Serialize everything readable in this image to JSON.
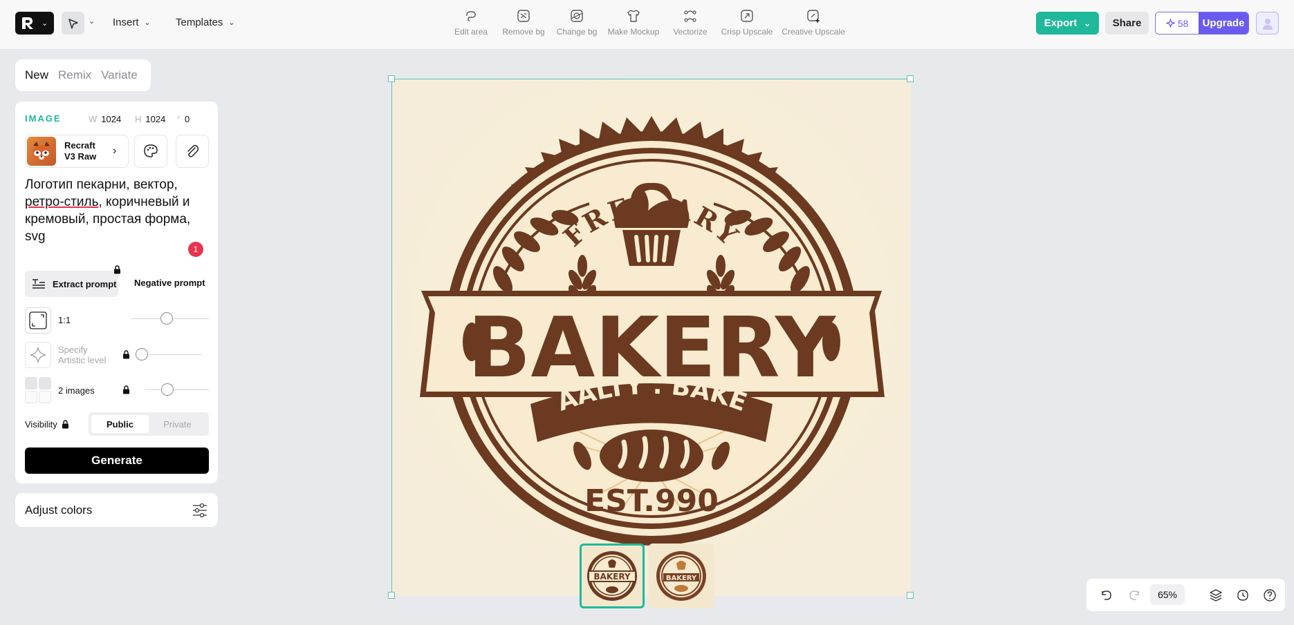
{
  "topbar": {
    "insert_label": "Insert",
    "templates_label": "Templates",
    "tools": [
      {
        "label": "Edit area",
        "icon": "lasso-icon"
      },
      {
        "label": "Remove bg",
        "icon": "remove-bg-icon"
      },
      {
        "label": "Change bg",
        "icon": "change-bg-icon"
      },
      {
        "label": "Make Mockup",
        "icon": "tshirt-icon"
      },
      {
        "label": "Vectorize",
        "icon": "vector-nodes-icon"
      },
      {
        "label": "Crisp Upscale",
        "icon": "upscale-icon"
      },
      {
        "label": "Creative Upscale",
        "icon": "creative-upscale-icon"
      }
    ],
    "export_label": "Export",
    "share_label": "Share",
    "credits": "58",
    "upgrade_label": "Upgrade"
  },
  "mode_tabs": {
    "new": "New",
    "remix": "Remix",
    "variate": "Variate"
  },
  "panel": {
    "image_label": "IMAGE",
    "width_key": "W",
    "width": "1024",
    "height_key": "H",
    "height": "1024",
    "rotation": "0",
    "model_name_1": "Recraft",
    "model_name_2": "V3 Raw",
    "prompt_part1": "Логотип пекарни, вектор, ",
    "prompt_underlined": "ретро-стиль",
    "prompt_part2": ", коричневый и кремовый, простая форма, svg",
    "prompt_badge": "1",
    "extract_label": "Extract prompt",
    "negative_label": "Negative prompt",
    "ratio_label": "1:1",
    "artistic_label_1": "Specify",
    "artistic_label_2": "Artistic level",
    "images_label": "2 images",
    "visibility_label": "Visibility",
    "public_label": "Public",
    "private_label": "Private",
    "generate_label": "Generate",
    "adjust_colors_label": "Adjust colors"
  },
  "logo": {
    "top_text": "FRESIARY",
    "banner_text": "BAKERY",
    "ribbon_text": "BAALTY . BAKES",
    "est_text": "EST.990",
    "colors": {
      "brown": "#6b3a20",
      "cream": "#f8ebcf",
      "background": "#f5ecd9"
    }
  },
  "bottombar": {
    "zoom": "65%"
  },
  "colors": {
    "accent": "#1fb89a",
    "purple": "#6a5af0",
    "badge": "#e8344e"
  }
}
